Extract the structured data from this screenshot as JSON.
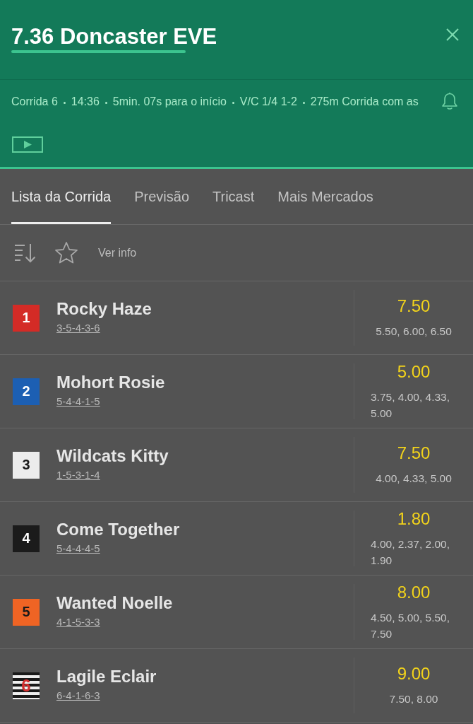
{
  "header": {
    "title": "7.36 Doncaster EVE",
    "race_info": [
      "Corrida 6",
      "14:36",
      "5min. 07s para o início",
      "V/C 1/4 1-2",
      "275m Corrida com as"
    ]
  },
  "tabs": [
    {
      "label": "Lista da Corrida",
      "selected": true
    },
    {
      "label": "Previsão",
      "selected": false
    },
    {
      "label": "Tricast",
      "selected": false
    },
    {
      "label": "Mais Mercados",
      "selected": false
    }
  ],
  "toolbar": {
    "favorite": false,
    "info_link": "Ver info"
  },
  "runners": [
    {
      "saddle_cloth": {
        "number": "1",
        "color": "#d42b26",
        "kind": "plain"
      },
      "name": "Rocky Haze",
      "form": "3-5-4-3-6",
      "odds": "7.50",
      "place_odds": "5.50, 6.00, 6.50"
    },
    {
      "saddle_cloth": {
        "number": "2",
        "color": "#1c5fb3",
        "kind": "plain"
      },
      "name": "Mohort Rosie",
      "form": "5-4-4-1-5",
      "odds": "5.00",
      "place_odds": "3.75, 4.00, 4.33, 5.00"
    },
    {
      "saddle_cloth": {
        "number": "3",
        "color": "#ececec",
        "kind": "plain"
      },
      "name": "Wildcats Kitty",
      "form": "1-5-3-1-4",
      "odds": "7.50",
      "place_odds": "4.00, 4.33, 5.00"
    },
    {
      "saddle_cloth": {
        "number": "4",
        "color": "#1b1b1b",
        "kind": "plain"
      },
      "name": "Come Together",
      "form": "5-4-4-4-5",
      "odds": "1.80",
      "place_odds": "4.00, 2.37, 2.00, 1.90"
    },
    {
      "saddle_cloth": {
        "number": "5",
        "color": "#ef6424",
        "kind": "plain"
      },
      "name": "Wanted Noelle",
      "form": "4-1-5-3-3",
      "odds": "8.00",
      "place_odds": "4.50, 5.00, 5.50, 7.50"
    },
    {
      "saddle_cloth": {
        "number": "6",
        "color": "#1a1a1a",
        "kind": "striped"
      },
      "name": "Lagile Eclair",
      "form": "6-4-1-6-3",
      "odds": "9.00",
      "place_odds": "7.50, 8.00"
    }
  ]
}
